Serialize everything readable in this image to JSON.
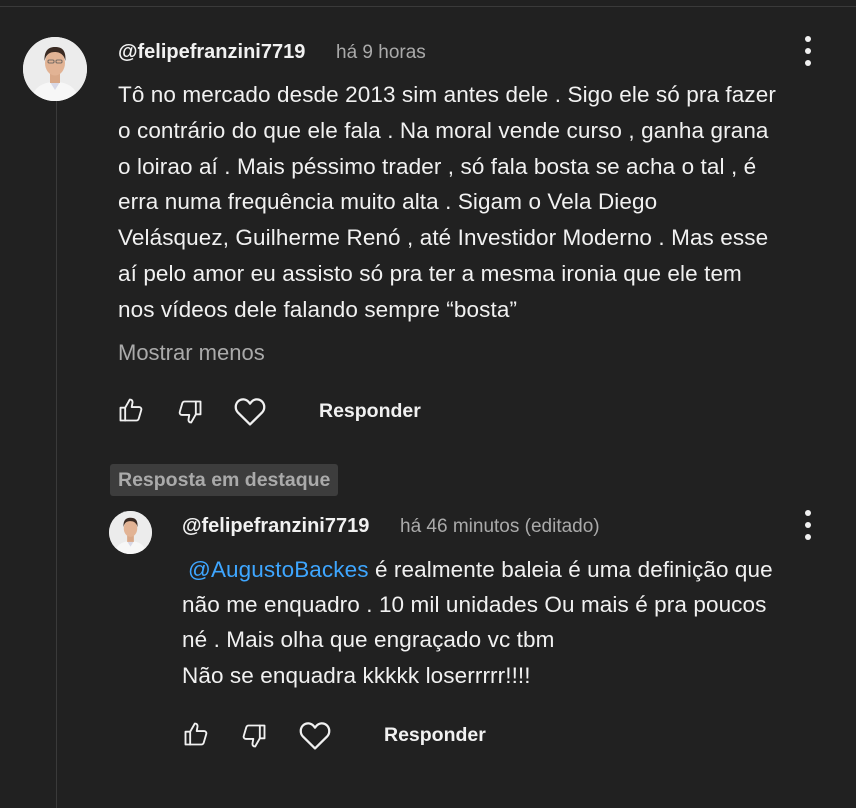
{
  "comment": {
    "author": "@felipefranzini7719",
    "time": "há 9 horas",
    "lines": [
      "Tô no mercado desde 2013 sim antes dele . Sigo ele só pra fazer",
      "o contrário do que ele fala . Na moral vende curso , ganha grana",
      "o loirao aí . Mais péssimo trader , só fala bosta se acha o tal , é",
      "erra numa frequência muito alta .  Sigam o Vela Diego",
      "Velásquez, Guilherme Renó , até Investidor Moderno . Mas esse",
      "aí pelo amor eu assisto só pra ter a mesma ironia que ele tem",
      "nos vídeos dele falando sempre “bosta”"
    ],
    "show_less": "Mostrar menos",
    "reply_label": "Responder"
  },
  "reply": {
    "badge": "Resposta em destaque",
    "author": "@felipefranzini7719",
    "time": "há 46 minutos (editado)",
    "mention": "@AugustoBackes",
    "line1_rest": " é realmente baleia é uma definição que",
    "lines": [
      "não me enquadro . 10 mil unidades  Ou mais é pra poucos",
      "né . Mais olha que engraçado vc tbm",
      "Não se enquadra kkkkk loserrrrr!!!!"
    ],
    "reply_label": "Responder"
  },
  "icons": {
    "like": "thumbs-up-icon",
    "dislike": "thumbs-down-icon",
    "heart": "heart-icon",
    "menu": "more-vertical-icon"
  },
  "colors": {
    "background": "#212121",
    "text": "#f1f1f1",
    "secondary": "#aaaaaa",
    "mention": "#3ea6ff",
    "badge_bg": "#3d3d3d"
  }
}
